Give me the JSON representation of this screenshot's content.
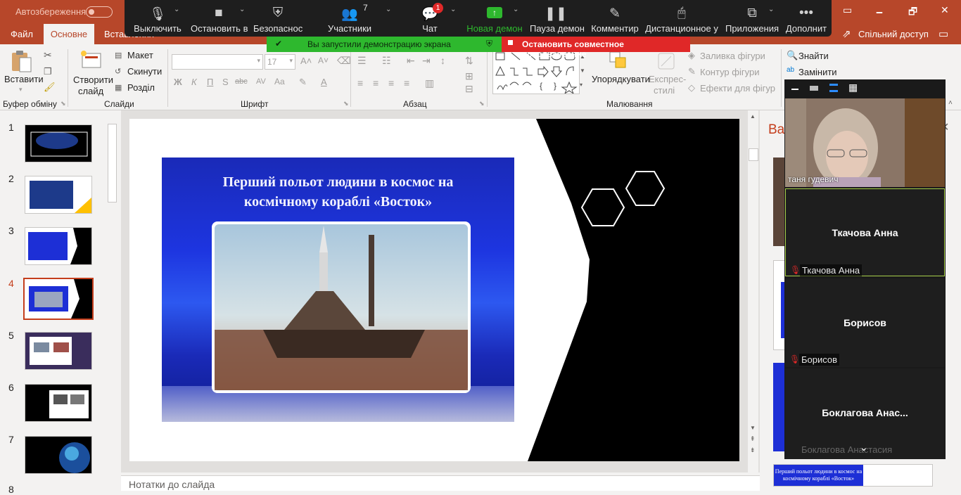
{
  "titlebar": {
    "autosave": "Автозбереження",
    "min": "🗕",
    "restore": "🗗",
    "close": "✕"
  },
  "tabs": [
    {
      "label": "Файл"
    },
    {
      "label": "Основне"
    },
    {
      "label": "Вставлення"
    }
  ],
  "share": {
    "label": "Спільний доступ"
  },
  "zoom": {
    "items": [
      {
        "label": "Выключить",
        "icon": "microphone-icon"
      },
      {
        "label": "Остановить в",
        "icon": "video-icon"
      },
      {
        "label": "Безопаснос",
        "icon": "shield-icon"
      },
      {
        "label": "Участники",
        "icon": "participants-icon",
        "count": "7"
      },
      {
        "label": "Чат",
        "icon": "chat-icon",
        "badge": "1"
      },
      {
        "label": "Новая демон",
        "icon": "share-screen-icon"
      },
      {
        "label": "Пауза демон",
        "icon": "pause-icon"
      },
      {
        "label": "Комментир",
        "icon": "pen-icon"
      },
      {
        "label": "Дистанционное у",
        "icon": "mouse-icon"
      },
      {
        "label": "Приложения",
        "icon": "apps-icon"
      },
      {
        "label": "Дополнит",
        "icon": "more-icon"
      }
    ],
    "banner_green": "Вы запустили демонстрацию экрана",
    "banner_red": "Остановить совместное использование"
  },
  "ribbon": {
    "clipboard": {
      "paste": "Вставити",
      "group": "Буфер обміну"
    },
    "slides": {
      "new_slide_1": "Створити",
      "new_slide_2": "слайд",
      "layout": "Макет",
      "reset": "Скинути",
      "section": "Розділ",
      "group": "Слайди"
    },
    "font": {
      "size": "17",
      "group": "Шрифт",
      "bold": "Ж",
      "italic": "К",
      "underline": "П",
      "shadow": "S",
      "strike": "abc",
      "spacing": "AV",
      "case": "Aa"
    },
    "paragraph": {
      "group": "Абзац"
    },
    "drawing": {
      "arrange": "Упорядкувати",
      "quick_1": "Експрес-",
      "quick_2": "стилі",
      "fill": "Заливка фігури",
      "outline": "Контур фігури",
      "effects": "Ефекти для фігур",
      "group": "Малювання"
    },
    "editing": {
      "find": "Знайти",
      "replace": "Замінити"
    }
  },
  "thumbnails": [
    {
      "num": "1"
    },
    {
      "num": "2"
    },
    {
      "num": "3"
    },
    {
      "num": "4"
    },
    {
      "num": "5"
    },
    {
      "num": "6"
    },
    {
      "num": "7"
    },
    {
      "num": "8"
    }
  ],
  "slide": {
    "title_line1": "Перший польот людини в космос на",
    "title_line2": "космічному кораблі «Восток»"
  },
  "notes": {
    "placeholder": "Нотатки до слайда"
  },
  "design_pane": {
    "title": "Ва"
  },
  "participants": {
    "self": {
      "name": "таня гудевич"
    },
    "tiles": [
      {
        "big": "Ткачова Анна",
        "label": "Ткачова Анна"
      },
      {
        "big": "Борисов",
        "label": "Борисов"
      },
      {
        "big": "Боклагова  Анас...",
        "label": "Боклагова Анастасия"
      }
    ]
  },
  "preview_caption": {
    "line1": "Перший польот людини в космос на",
    "line2": "космічному кораблі «Восток»"
  },
  "colors": {
    "accent": "#b7472a",
    "zoom_bg": "#1e1e1e",
    "green": "#2eb82e",
    "red": "#e02828",
    "slide_blue": "#1d2fd6"
  }
}
